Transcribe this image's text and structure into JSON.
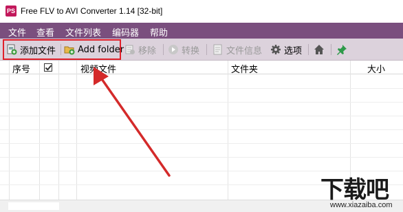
{
  "window": {
    "icon_text": "PS",
    "title": "Free FLV to AVI Converter 1.14  [32-bit]"
  },
  "menu": [
    "文件",
    "查看",
    "文件列表",
    "编码器",
    "帮助"
  ],
  "toolbar": {
    "add_file": "添加文件",
    "add_folder": "Add folder",
    "remove": "移除",
    "convert": "转换",
    "file_info": "文件信息",
    "options": "选项"
  },
  "columns": {
    "index": "序号",
    "video_file": "视频文件",
    "folder": "文件夹",
    "size": "大小"
  },
  "watermark": {
    "main": "下载吧",
    "sub": "www.xiazaiba.com"
  },
  "colors": {
    "menubar": "#7a4f7e",
    "toolbar": "#dcd2dc",
    "highlight": "#e0202a"
  }
}
